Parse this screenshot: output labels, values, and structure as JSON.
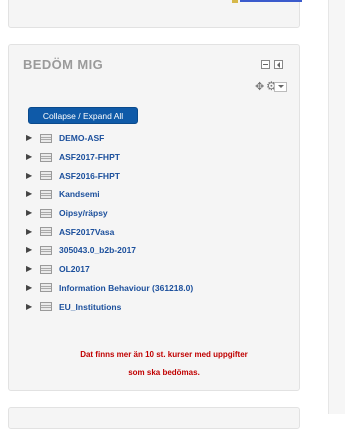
{
  "block": {
    "title": "BEDÖM MIG",
    "controls": {
      "collapse_icon": "minus-box-icon",
      "dock_icon": "dock-arrow-icon",
      "move_icon": "move-icon",
      "settings_icon": "gear-icon"
    },
    "expand_button_label": "Collapse / Expand All",
    "courses": [
      {
        "label": "DEMO-ASF"
      },
      {
        "label": "ASF2017-FHPT"
      },
      {
        "label": "ASF2016-FHPT"
      },
      {
        "label": "Kandsemi"
      },
      {
        "label": "Oipsy/räpsy"
      },
      {
        "label": "ASF2017Vasa"
      },
      {
        "label": "305043.0_b2b-2017"
      },
      {
        "label": "OL2017"
      },
      {
        "label": "Information Behaviour (361218.0)"
      },
      {
        "label": "EU_Institutions"
      }
    ],
    "notice_line1": "Dat finns mer än 10 st. kurser med uppgifter",
    "notice_line2": "som ska bedömas."
  },
  "colors": {
    "accent_button": "#0f5aa8",
    "link_text": "#1b4f9c",
    "notice_text": "#c00000",
    "title_text": "#9a9a9a"
  }
}
